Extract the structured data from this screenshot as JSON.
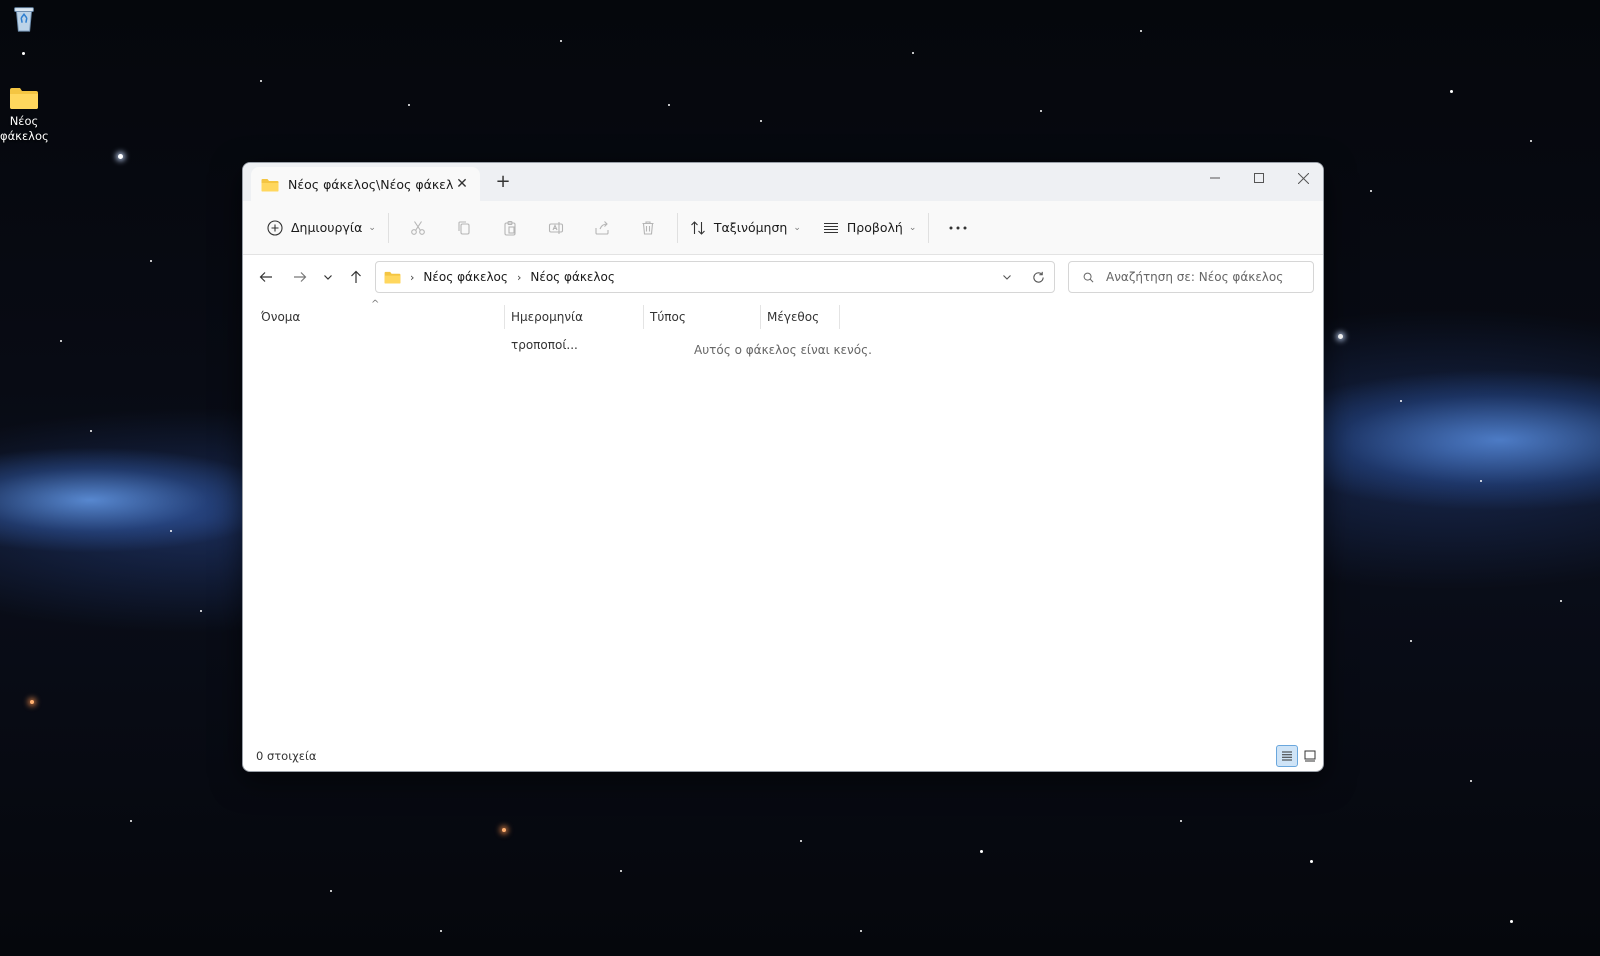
{
  "desktop": {
    "folder_label": "Νέος φάκελος"
  },
  "window": {
    "tab_title": "Νέος φάκελος\\Νέος φάκελος",
    "toolbar": {
      "new_label": "Δημιουργία",
      "sort_label": "Ταξινόμηση",
      "view_label": "Προβολή"
    },
    "address": {
      "crumbs": [
        "Νέος φάκελος",
        "Νέος φάκελος"
      ]
    },
    "search": {
      "placeholder": "Αναζήτηση σε: Νέος φάκελος"
    },
    "columns": {
      "name": "Όνομα",
      "date": "Ημερομηνία τροποποί...",
      "type": "Τύπος",
      "size": "Μέγεθος"
    },
    "empty_message": "Αυτός ο φάκελος είναι κενός.",
    "status": {
      "item_count": "0 στοιχεία"
    }
  },
  "colors": {
    "accent": "#0067c0",
    "folder": "#f4c542",
    "selected_view": "#cfe4f7"
  },
  "icons": [
    "recycle-bin-icon",
    "folder-icon",
    "close-icon",
    "plus-icon",
    "minimize-icon",
    "maximize-icon",
    "plus-circle-icon",
    "scissors-icon",
    "copy-icon",
    "paste-icon",
    "rename-icon",
    "share-icon",
    "trash-icon",
    "sort-icon",
    "view-list-icon",
    "more-icon",
    "back-arrow-icon",
    "forward-arrow-icon",
    "chevron-down-icon",
    "up-arrow-icon",
    "refresh-icon",
    "search-icon",
    "details-view-icon",
    "large-icons-view-icon"
  ]
}
